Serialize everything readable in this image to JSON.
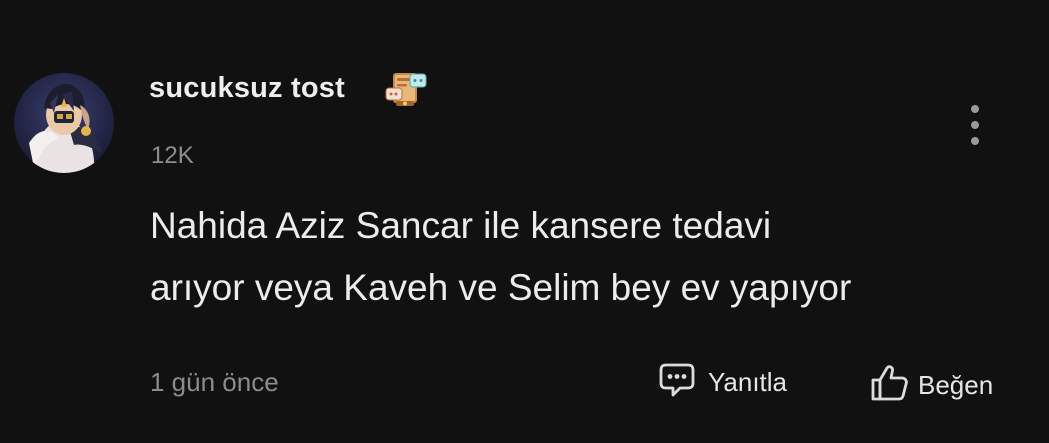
{
  "comment": {
    "author": "sucuksuz tost",
    "badge_icon": "chat-badge-icon",
    "count": "12K",
    "text_lines": [
      "Nahida Aziz Sancar ile kansere tedavi",
      "arıyor veya Kaveh ve Selim bey ev yapıyor"
    ],
    "time": "1 gün önce",
    "actions": {
      "reply_label": "Yanıtla",
      "like_label": "Beğen"
    }
  },
  "colors": {
    "background": "#111112",
    "text_primary": "#ececec",
    "text_secondary": "#8c8c8e"
  }
}
